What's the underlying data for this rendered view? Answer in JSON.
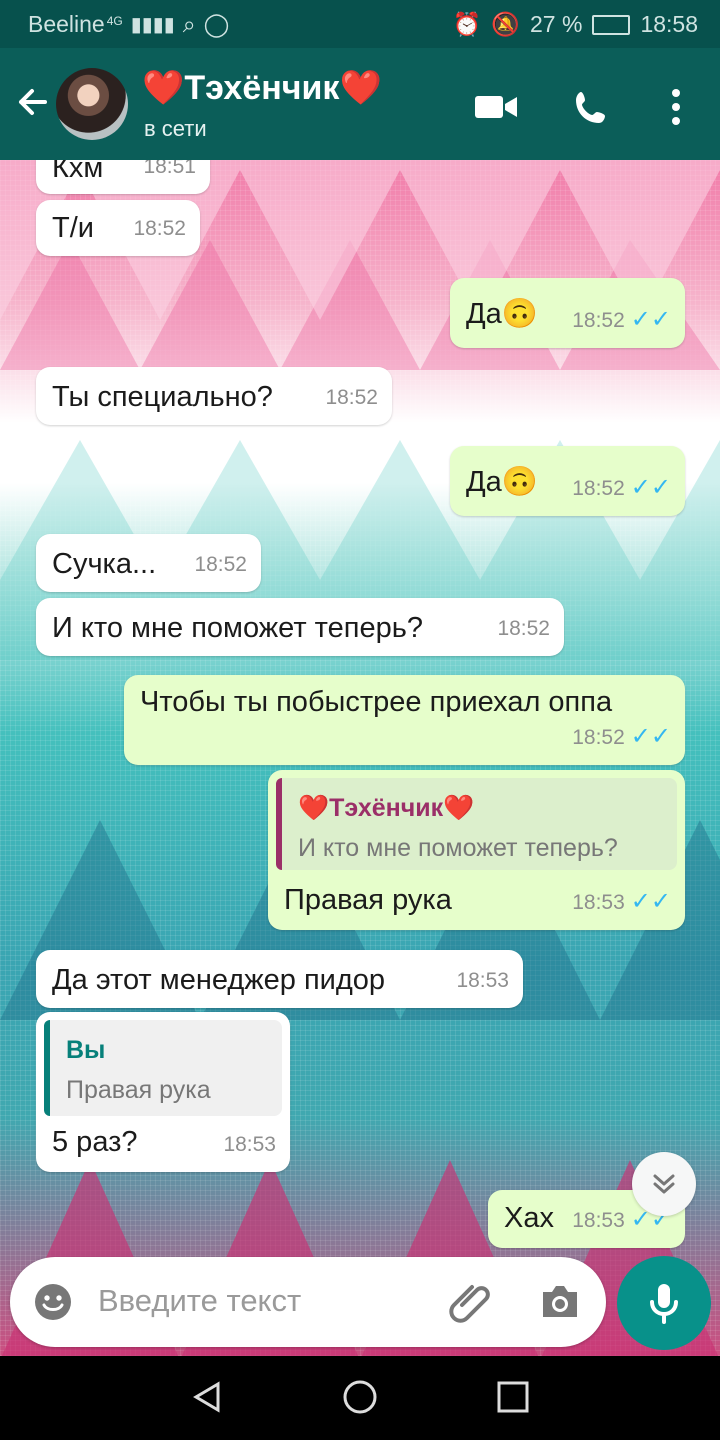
{
  "status_bar": {
    "carrier": "Beeline",
    "network": "4G",
    "battery": "27 %",
    "time": "18:58"
  },
  "header": {
    "contact_name": "❤️Тэхёнчик❤️",
    "status": "в сети"
  },
  "messages": [
    {
      "text": "Кхм",
      "time": "18:51"
    },
    {
      "text": "Т/и",
      "time": "18:52"
    },
    {
      "text": "Да🙃",
      "time": "18:52"
    },
    {
      "text": "Ты специально?",
      "time": "18:52"
    },
    {
      "text": "Да🙃",
      "time": "18:52"
    },
    {
      "text": "Сучка...",
      "time": "18:52"
    },
    {
      "text": "И кто мне поможет теперь?",
      "time": "18:52"
    },
    {
      "text": "Чтобы ты побыстрее приехал оппа",
      "time": "18:52"
    },
    {
      "reply_name": "❤️Тэхёнчик❤️",
      "reply_text": "И кто мне поможет теперь?",
      "text": "Правая рука",
      "time": "18:53"
    },
    {
      "text": "Да этот менеджер пидор",
      "time": "18:53"
    },
    {
      "reply_name": "Вы",
      "reply_text": "Правая рука",
      "text": "5 раз?",
      "time": "18:53"
    },
    {
      "text": "Хах",
      "time": "18:53"
    }
  ],
  "input": {
    "placeholder": "Введите текст"
  },
  "colors": {
    "header": "#0b5e59",
    "outgoing_bubble": "#e6fecb",
    "incoming_bubble": "#ffffff",
    "read_checks": "#34b7f1",
    "fab": "#08918a",
    "reply_contact": "#9b2f68",
    "reply_self": "#07807a"
  }
}
